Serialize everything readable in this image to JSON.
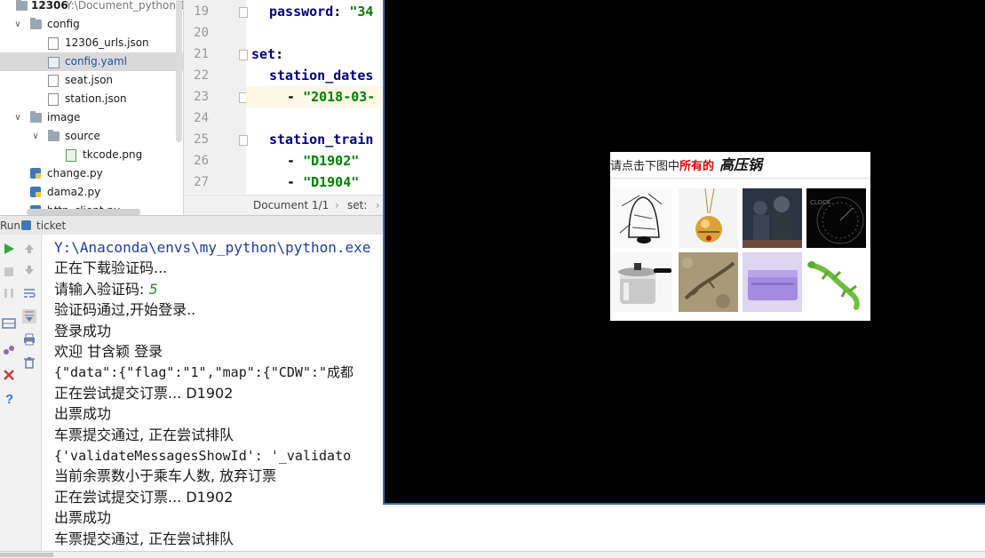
{
  "project_tree": {
    "root": {
      "name": "12306",
      "path": "Y:\\Document_python\\1"
    },
    "items": [
      {
        "label": "config",
        "type": "folder",
        "expanded": true,
        "depth": 1
      },
      {
        "label": "12306_urls.json",
        "type": "json",
        "depth": 2
      },
      {
        "label": "config.yaml",
        "type": "yaml",
        "depth": 2,
        "selected": true
      },
      {
        "label": "seat.json",
        "type": "json",
        "depth": 2
      },
      {
        "label": "station.json",
        "type": "json",
        "depth": 2
      },
      {
        "label": "image",
        "type": "folder",
        "expanded": true,
        "depth": 1
      },
      {
        "label": "source",
        "type": "folder",
        "expanded": true,
        "depth": 2
      },
      {
        "label": "tkcode.png",
        "type": "png",
        "depth": 3
      },
      {
        "label": "change.py",
        "type": "py",
        "depth": 1
      },
      {
        "label": "dama2.py",
        "type": "py",
        "depth": 1
      },
      {
        "label": "http_client.py",
        "type": "py",
        "depth": 1
      }
    ]
  },
  "editor": {
    "lines": [
      {
        "num": "19",
        "key": "password",
        "sep": ": ",
        "value": "\"34"
      },
      {
        "num": "20"
      },
      {
        "num": "21",
        "key": "set",
        "sep": ":"
      },
      {
        "num": "22",
        "key": "station_dates",
        "sep": ""
      },
      {
        "num": "23",
        "dash": "- ",
        "value": "\"2018-03-"
      },
      {
        "num": "24"
      },
      {
        "num": "25",
        "key": "station_train",
        "sep": ""
      },
      {
        "num": "26",
        "dash": "- ",
        "value": "\"D1902\""
      },
      {
        "num": "27",
        "dash": "- ",
        "value": "\"D1904\""
      }
    ],
    "breadcrumb": {
      "document": "Document 1/1",
      "sep": "›",
      "path": "set:",
      "sep2": "›"
    }
  },
  "run_panel": {
    "header_label": "Run",
    "config_name": "ticket",
    "console": [
      {
        "text": "Y:\\Anaconda\\envs\\my_python\\python.exe",
        "style": "path"
      },
      {
        "text": "正在下载验证码...",
        "style": "normal"
      },
      {
        "text": "请输入验证码: ",
        "input": "5",
        "style": "normal"
      },
      {
        "text": "验证码通过,开始登录..",
        "style": "normal"
      },
      {
        "text": "登录成功",
        "style": "normal"
      },
      {
        "text": "欢迎 甘含颖 登录",
        "style": "normal"
      },
      {
        "text": "{\"data\":{\"flag\":\"1\",\"map\":{\"CDW\":\"成都",
        "style": "mono"
      },
      {
        "text": "正在尝试提交订票... D1902",
        "style": "normal"
      },
      {
        "text": "出票成功",
        "style": "normal"
      },
      {
        "text": "车票提交通过, 正在尝试排队",
        "style": "normal"
      },
      {
        "text": "{'validateMessagesShowId': '_validato",
        "style": "mono"
      },
      {
        "text": "当前余票数小于乘车人数, 放弃订票",
        "style": "normal"
      },
      {
        "text": "正在尝试提交订票... D1902",
        "style": "normal"
      },
      {
        "text": "出票成功",
        "style": "normal"
      },
      {
        "text": "车票提交通过, 正在尝试排队",
        "style": "normal"
      }
    ]
  },
  "captcha": {
    "prompt_prefix": "请点击下图中",
    "prompt_highlight": "所有的",
    "target_word": "高压锅",
    "tiles": [
      {
        "name": "bell-sketch"
      },
      {
        "name": "golden-bell"
      },
      {
        "name": "soldier-poster"
      },
      {
        "name": "dark-dial"
      },
      {
        "name": "pressure-cooker"
      },
      {
        "name": "lizard-photo"
      },
      {
        "name": "purple-case"
      },
      {
        "name": "green-lizard"
      }
    ]
  },
  "colors": {
    "keyword": "#000080",
    "string": "#008000",
    "console_path": "#1f3ca8",
    "prompt_red": "#e00000"
  }
}
